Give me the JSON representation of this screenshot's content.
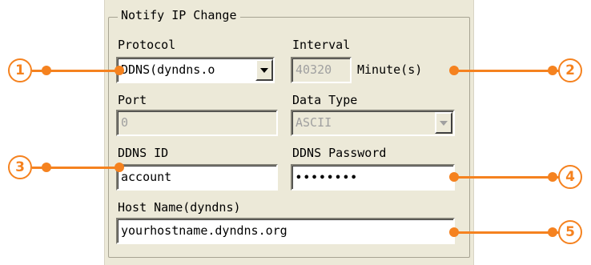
{
  "group": {
    "title": "Notify IP Change"
  },
  "protocol": {
    "label": "Protocol",
    "value": "DDNS(dyndns.o"
  },
  "interval": {
    "label": "Interval",
    "value": "40320",
    "unit": "Minute(s)"
  },
  "port": {
    "label": "Port",
    "value": "0"
  },
  "data_type": {
    "label": "Data Type",
    "value": "ASCII"
  },
  "ddns_id": {
    "label": "DDNS ID",
    "value": "account"
  },
  "ddns_password": {
    "label": "DDNS Password",
    "value": "••••••••"
  },
  "host_name": {
    "label": "Host Name(dyndns)",
    "value": "yourhostname.dyndns.org"
  },
  "callouts": [
    "1",
    "2",
    "3",
    "4",
    "5"
  ],
  "colors": {
    "callout": "#f5821f",
    "panel": "#ece9d8"
  }
}
